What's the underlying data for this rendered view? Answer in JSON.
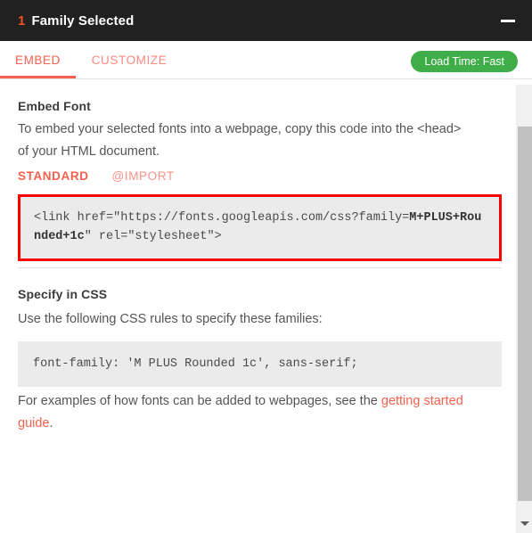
{
  "titlebar": {
    "count": "1",
    "title": "Family Selected",
    "minimize_label": "Minimize"
  },
  "tabs": [
    {
      "id": "embed",
      "label": "EMBED",
      "active": true
    },
    {
      "id": "customize",
      "label": "CUSTOMIZE",
      "active": false
    }
  ],
  "load_time": {
    "label": "Load Time: Fast",
    "color": "#3fae49"
  },
  "embed_section": {
    "heading": "Embed Font",
    "description": "To embed your selected fonts into a webpage, copy this code into the <head> of your HTML document.",
    "subtabs": [
      {
        "id": "standard",
        "label": "STANDARD",
        "active": true
      },
      {
        "id": "import",
        "label": "@IMPORT",
        "active": false
      }
    ],
    "code_prefix": "<link href=\"https://fonts.googleapis.com/css?family=",
    "code_family": "M+PLUS+Rounded+1c",
    "code_suffix": "\" rel=\"stylesheet\">",
    "code_border_color": "#ff0000"
  },
  "css_section": {
    "heading": "Specify in CSS",
    "description": "Use the following CSS rules to specify these families:",
    "code": "font-family: 'M PLUS Rounded 1c', sans-serif;"
  },
  "footer": {
    "text_before": "For examples of how fonts can be added to webpages, see the ",
    "link_text": "getting started guide",
    "text_after": "."
  },
  "scrollbar": {
    "down_arrow": "scroll-down-arrow"
  },
  "colors": {
    "accent": "#f8604e",
    "accent_muted": "#fa8a80",
    "header_bg": "#212121",
    "count_orange": "#f4511e",
    "code_bg": "#ebebeb"
  }
}
